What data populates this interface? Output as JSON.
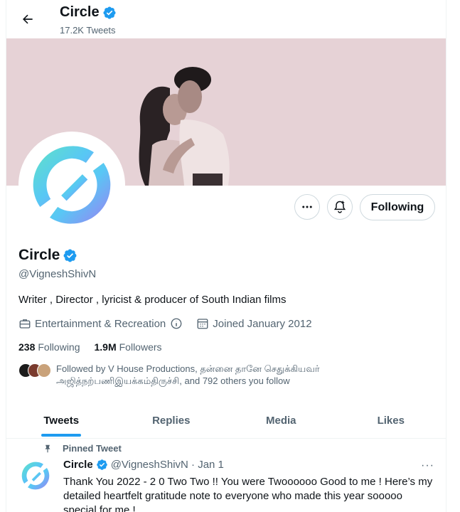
{
  "header": {
    "title": "Circle",
    "tweet_count": "17.2K Tweets"
  },
  "profile": {
    "name": "Circle",
    "handle": "@VigneshShivN",
    "bio": "Writer , Director , lyricist & producer of South Indian films",
    "category": "Entertainment & Recreation",
    "joined": "Joined January 2012",
    "following_count": "238",
    "following_label": "Following",
    "followers_count": "1.9M",
    "followers_label": "Followers",
    "followed_by": "Followed by V House Productions, தன்னை தானே செதுக்கியவர் அஜித்நற்பணிஇயக்கம்திருச்சி, and 792 others you follow"
  },
  "actions": {
    "following_button": "Following"
  },
  "tabs": [
    "Tweets",
    "Replies",
    "Media",
    "Likes"
  ],
  "active_tab": "Tweets",
  "pinned_tweet": {
    "label": "Pinned Tweet",
    "name": "Circle",
    "handle_date": "@VigneshShivN · Jan 1",
    "more": "···",
    "text": "Thank You 2022 - 2 0 Two Two !! You were Twoooooo Good to me ! Here’s my detailed heartfelt gratitude note to everyone who made this year sooooo special for me !"
  },
  "icons": [
    "back-arrow-icon",
    "verified-badge-icon",
    "more-icon",
    "notification-bell-icon",
    "briefcase-icon",
    "info-icon",
    "calendar-icon",
    "pin-icon"
  ],
  "colors": {
    "accent": "#1d9bf0",
    "text": "#0f1419",
    "secondary": "#536471",
    "banner": "#e8d4d8"
  }
}
